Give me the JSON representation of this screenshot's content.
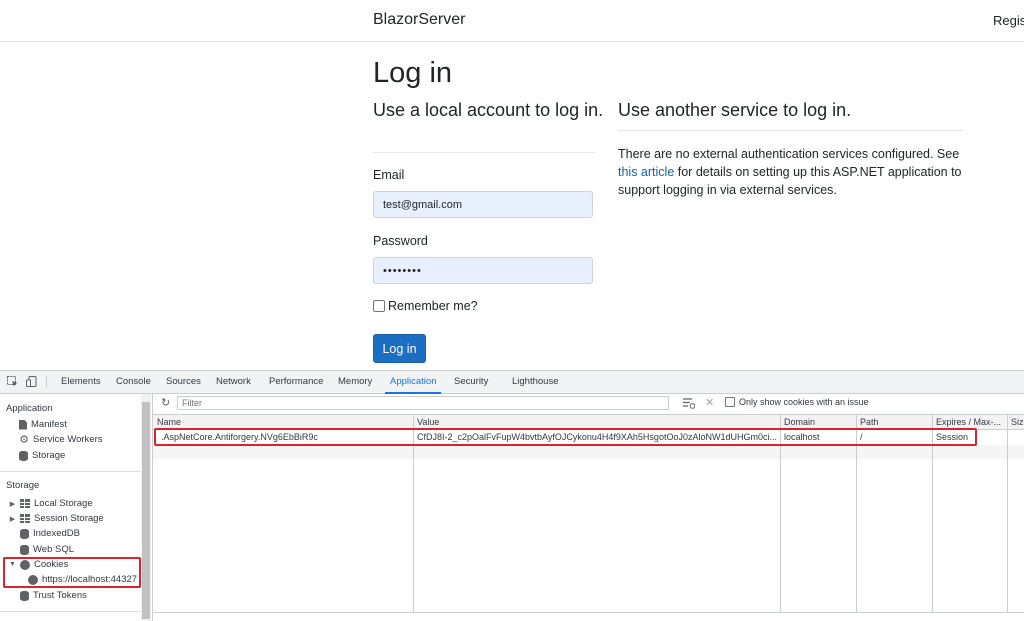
{
  "navbar": {
    "brand": "BlazorServer",
    "right_link": "Regist"
  },
  "login": {
    "title": "Log in",
    "local_heading": "Use a local account to log in.",
    "email_label": "Email",
    "email_value": "test@gmail.com",
    "password_label": "Password",
    "password_value": "••••••••",
    "remember_label": "Remember me?",
    "submit_label": "Log in"
  },
  "external": {
    "heading": "Use another service to log in.",
    "text_before": "There are no external authentication services configured. See ",
    "link": "this article",
    "text_after": " for details on setting up this ASP.NET application to support logging in via external services."
  },
  "devtools": {
    "tabs": [
      "Elements",
      "Console",
      "Sources",
      "Network",
      "Performance",
      "Memory",
      "Application",
      "Security",
      "Lighthouse"
    ],
    "active_tab": "Application",
    "sidebar": {
      "application_heading": "Application",
      "manifest": "Manifest",
      "service_workers": "Service Workers",
      "storage_item": "Storage",
      "storage_heading": "Storage",
      "local_storage": "Local Storage",
      "session_storage": "Session Storage",
      "indexeddb": "IndexedDB",
      "websql": "Web SQL",
      "cookies": "Cookies",
      "cookie_origin": "https://localhost:44327",
      "trust_tokens": "Trust Tokens"
    },
    "toolbar": {
      "filter_placeholder": "Filter",
      "only_issue_label": "Only show cookies with an issue"
    },
    "columns": [
      "Name",
      "Value",
      "Domain",
      "Path",
      "Expires / Max-...",
      "Size"
    ],
    "cookie_row": {
      "name": ".AspNetCore.Antiforgery.NVg6EbBiR9c",
      "value": "CfDJ8I-2_c2pOalFvFupW4bvtbAyfOJCykonu4H4f9XAh5HsgotOoJ0zAloNW1dUHGm0ci...",
      "domain": "localhost",
      "path": "/",
      "expires": "Session"
    }
  }
}
